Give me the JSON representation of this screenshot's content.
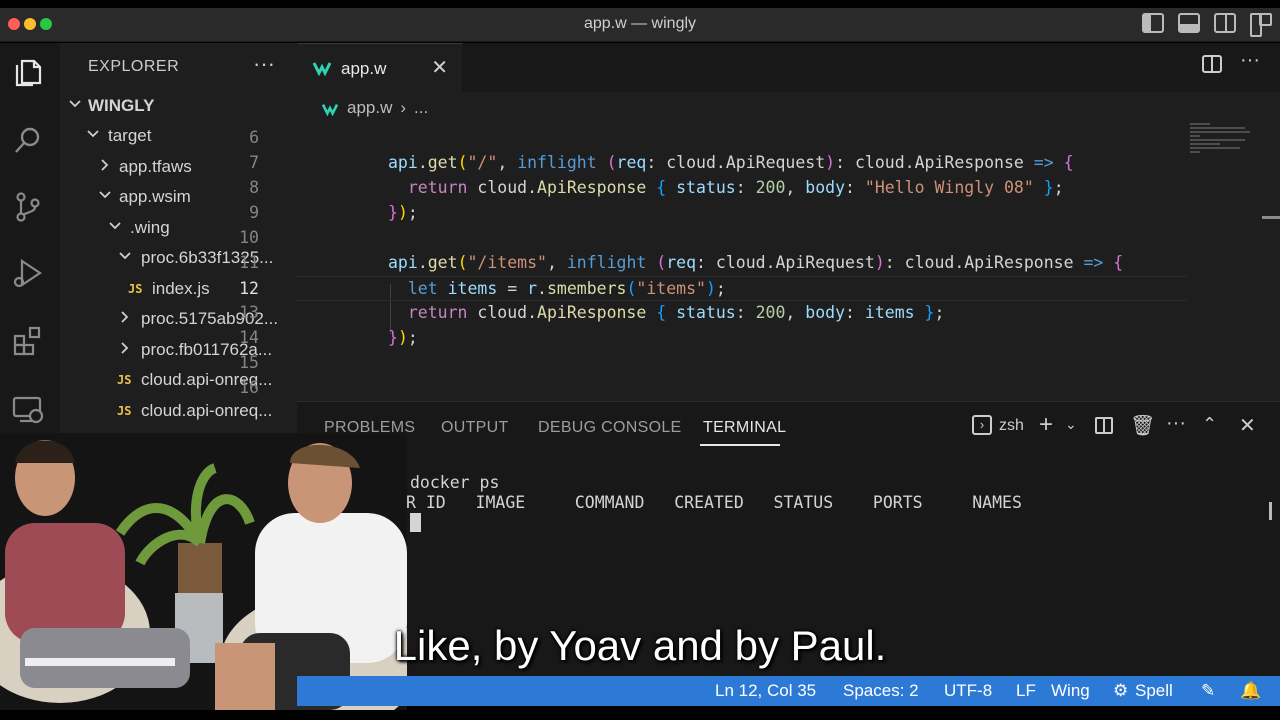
{
  "window": {
    "title": "app.w — wingly"
  },
  "activity_bar": {
    "items": [
      "explorer-icon",
      "search-icon",
      "source-control-icon",
      "run-debug-icon",
      "extensions-icon",
      "remote-explorer-icon"
    ]
  },
  "sidebar": {
    "header": "EXPLORER",
    "more": "···",
    "tree": [
      {
        "label": "WINGLY",
        "chevron": "down"
      },
      {
        "label": "target",
        "chevron": "down"
      },
      {
        "label": "app.tfaws",
        "chevron": "right"
      },
      {
        "label": "app.wsim",
        "chevron": "down"
      },
      {
        "label": ".wing",
        "chevron": "down"
      },
      {
        "label": "proc.6b33f1325...",
        "chevron": "down"
      },
      {
        "label": "index.js",
        "file_badge": "JS"
      },
      {
        "label": "proc.5175ab902...",
        "chevron": "right"
      },
      {
        "label": "proc.fb011762a...",
        "chevron": "right"
      },
      {
        "label": "cloud.api-onreq...",
        "file_badge": "JS"
      },
      {
        "label": "cloud.api-onreq...",
        "file_badge": "JS"
      }
    ]
  },
  "editor": {
    "tab": {
      "label": "app.w",
      "close": "✕"
    },
    "breadcrumb": {
      "file": "app.w",
      "rest": "..."
    },
    "more": "···",
    "line_numbers": [
      "6",
      "7",
      "8",
      "9",
      "10",
      "11",
      "12",
      "13",
      "14",
      "15",
      "16"
    ],
    "current_line": "12"
  },
  "panel": {
    "tabs": [
      "PROBLEMS",
      "OUTPUT",
      "DEBUG CONSOLE",
      "TERMINAL"
    ],
    "active_tab": "TERMINAL",
    "shell": "zsh",
    "more": "···",
    "terminal_lines": [
      "docker ps",
      "R ID   IMAGE     COMMAND   CREATED   STATUS    PORTS     NAMES"
    ]
  },
  "status_bar": {
    "position": "Ln 12, Col 35",
    "spaces": "Spaces: 2",
    "encoding": "UTF-8",
    "eol": "LF",
    "language": "Wing",
    "spell": "Spell"
  },
  "subtitle": "Like, by Yoav and by Paul.",
  "colors": {
    "accent": "#2d7ad6",
    "wing_logo": "#2fd3b4",
    "editor_bg": "#1e1e1e",
    "panel_bg": "#181818"
  }
}
